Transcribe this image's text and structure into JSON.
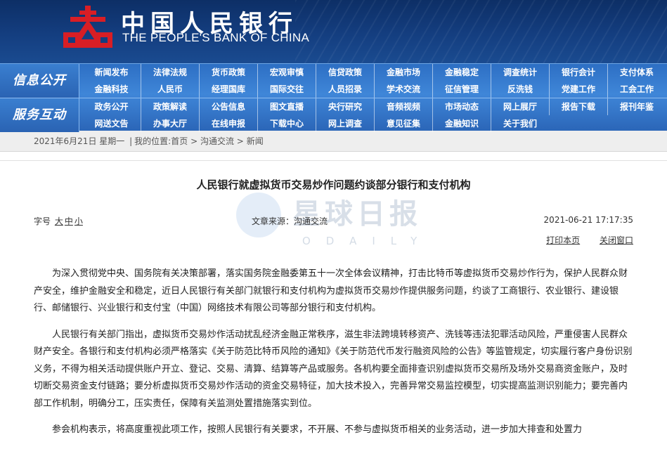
{
  "header": {
    "brand_cn": "中国人民银行",
    "brand_en": "THE PEOPLE'S BANK OF CHINA",
    "logo_icon": "pboc-emblem-icon",
    "colors": {
      "header_bg": "#143e80",
      "nav_bg": "#3f86d8",
      "emblem": "#d81e25"
    }
  },
  "nav": {
    "groups": [
      {
        "heading": "信息公开",
        "row1": [
          "新闻发布",
          "法律法规",
          "货币政策",
          "宏观审慎",
          "信贷政策",
          "金融市场",
          "金融稳定",
          "调查统计",
          "银行会计",
          "支付体系"
        ],
        "row2": [
          "金融科技",
          "人民币",
          "经理国库",
          "国际交往",
          "人员招录",
          "学术交流",
          "征信管理",
          "反洗钱",
          "党建工作",
          "工会工作"
        ]
      },
      {
        "heading": "服务互动",
        "row1": [
          "政务公开",
          "政策解读",
          "公告信息",
          "图文直播",
          "央行研究",
          "音频视频",
          "市场动态",
          "网上展厅",
          "报告下载",
          "报刊年鉴"
        ],
        "row2": [
          "网送文告",
          "办事大厅",
          "在线申报",
          "下载中心",
          "网上调查",
          "意见征集",
          "金融知识",
          "关于我们"
        ]
      }
    ]
  },
  "breadcrumb": {
    "date": "2021年6月21日",
    "weekday": "星期一",
    "separator": "|",
    "location_label": "我的位置:",
    "items": [
      "首页",
      "沟通交流",
      "新闻"
    ],
    "arrow": ">"
  },
  "article": {
    "title": "人民银行就虚拟货币交易炒作问题约谈部分银行和支付机构",
    "font_size_label": "字号",
    "font_sizes": [
      "大",
      "中",
      "小"
    ],
    "source_label": "文章来源：",
    "source": "沟通交流",
    "datetime": "2021-06-21 17:17:35",
    "print_link": "打印本页",
    "close_link": "关闭窗口",
    "paragraphs": [
      "为深入贯彻党中央、国务院有关决策部署，落实国务院金融委第五十一次全体会议精神，打击比特币等虚拟货币交易炒作行为，保护人民群众财产安全，维护金融安全和稳定，近日人民银行有关部门就银行和支付机构为虚拟货币交易炒作提供服务问题，约谈了工商银行、农业银行、建设银行、邮储银行、兴业银行和支付宝（中国）网络技术有限公司等部分银行和支付机构。",
      "人民银行有关部门指出，虚拟货币交易炒作活动扰乱经济金融正常秩序，滋生非法跨境转移资产、洗钱等违法犯罪活动风险，严重侵害人民群众财产安全。各银行和支付机构必须严格落实《关于防范比特币风险的通知》《关于防范代币发行融资风险的公告》等监管规定，切实履行客户身份识别义务，不得为相关活动提供账户开立、登记、交易、清算、结算等产品或服务。各机构要全面排查识别虚拟货币交易所及场外交易商资金账户，及时切断交易资金支付链路；要分析虚拟货币交易炒作活动的资金交易特征，加大技术投入，完善异常交易监控模型，切实提高监测识别能力；要完善内部工作机制，明确分工，压实责任，保障有关监测处置措施落实到位。",
      "参会机构表示，将高度重视此项工作，按照人民银行有关要求，不开展、不参与虚拟货币相关的业务活动，进一步加大排查和处置力"
    ],
    "watermark": {
      "cn": "星球日报",
      "en": "ODAILY"
    }
  }
}
